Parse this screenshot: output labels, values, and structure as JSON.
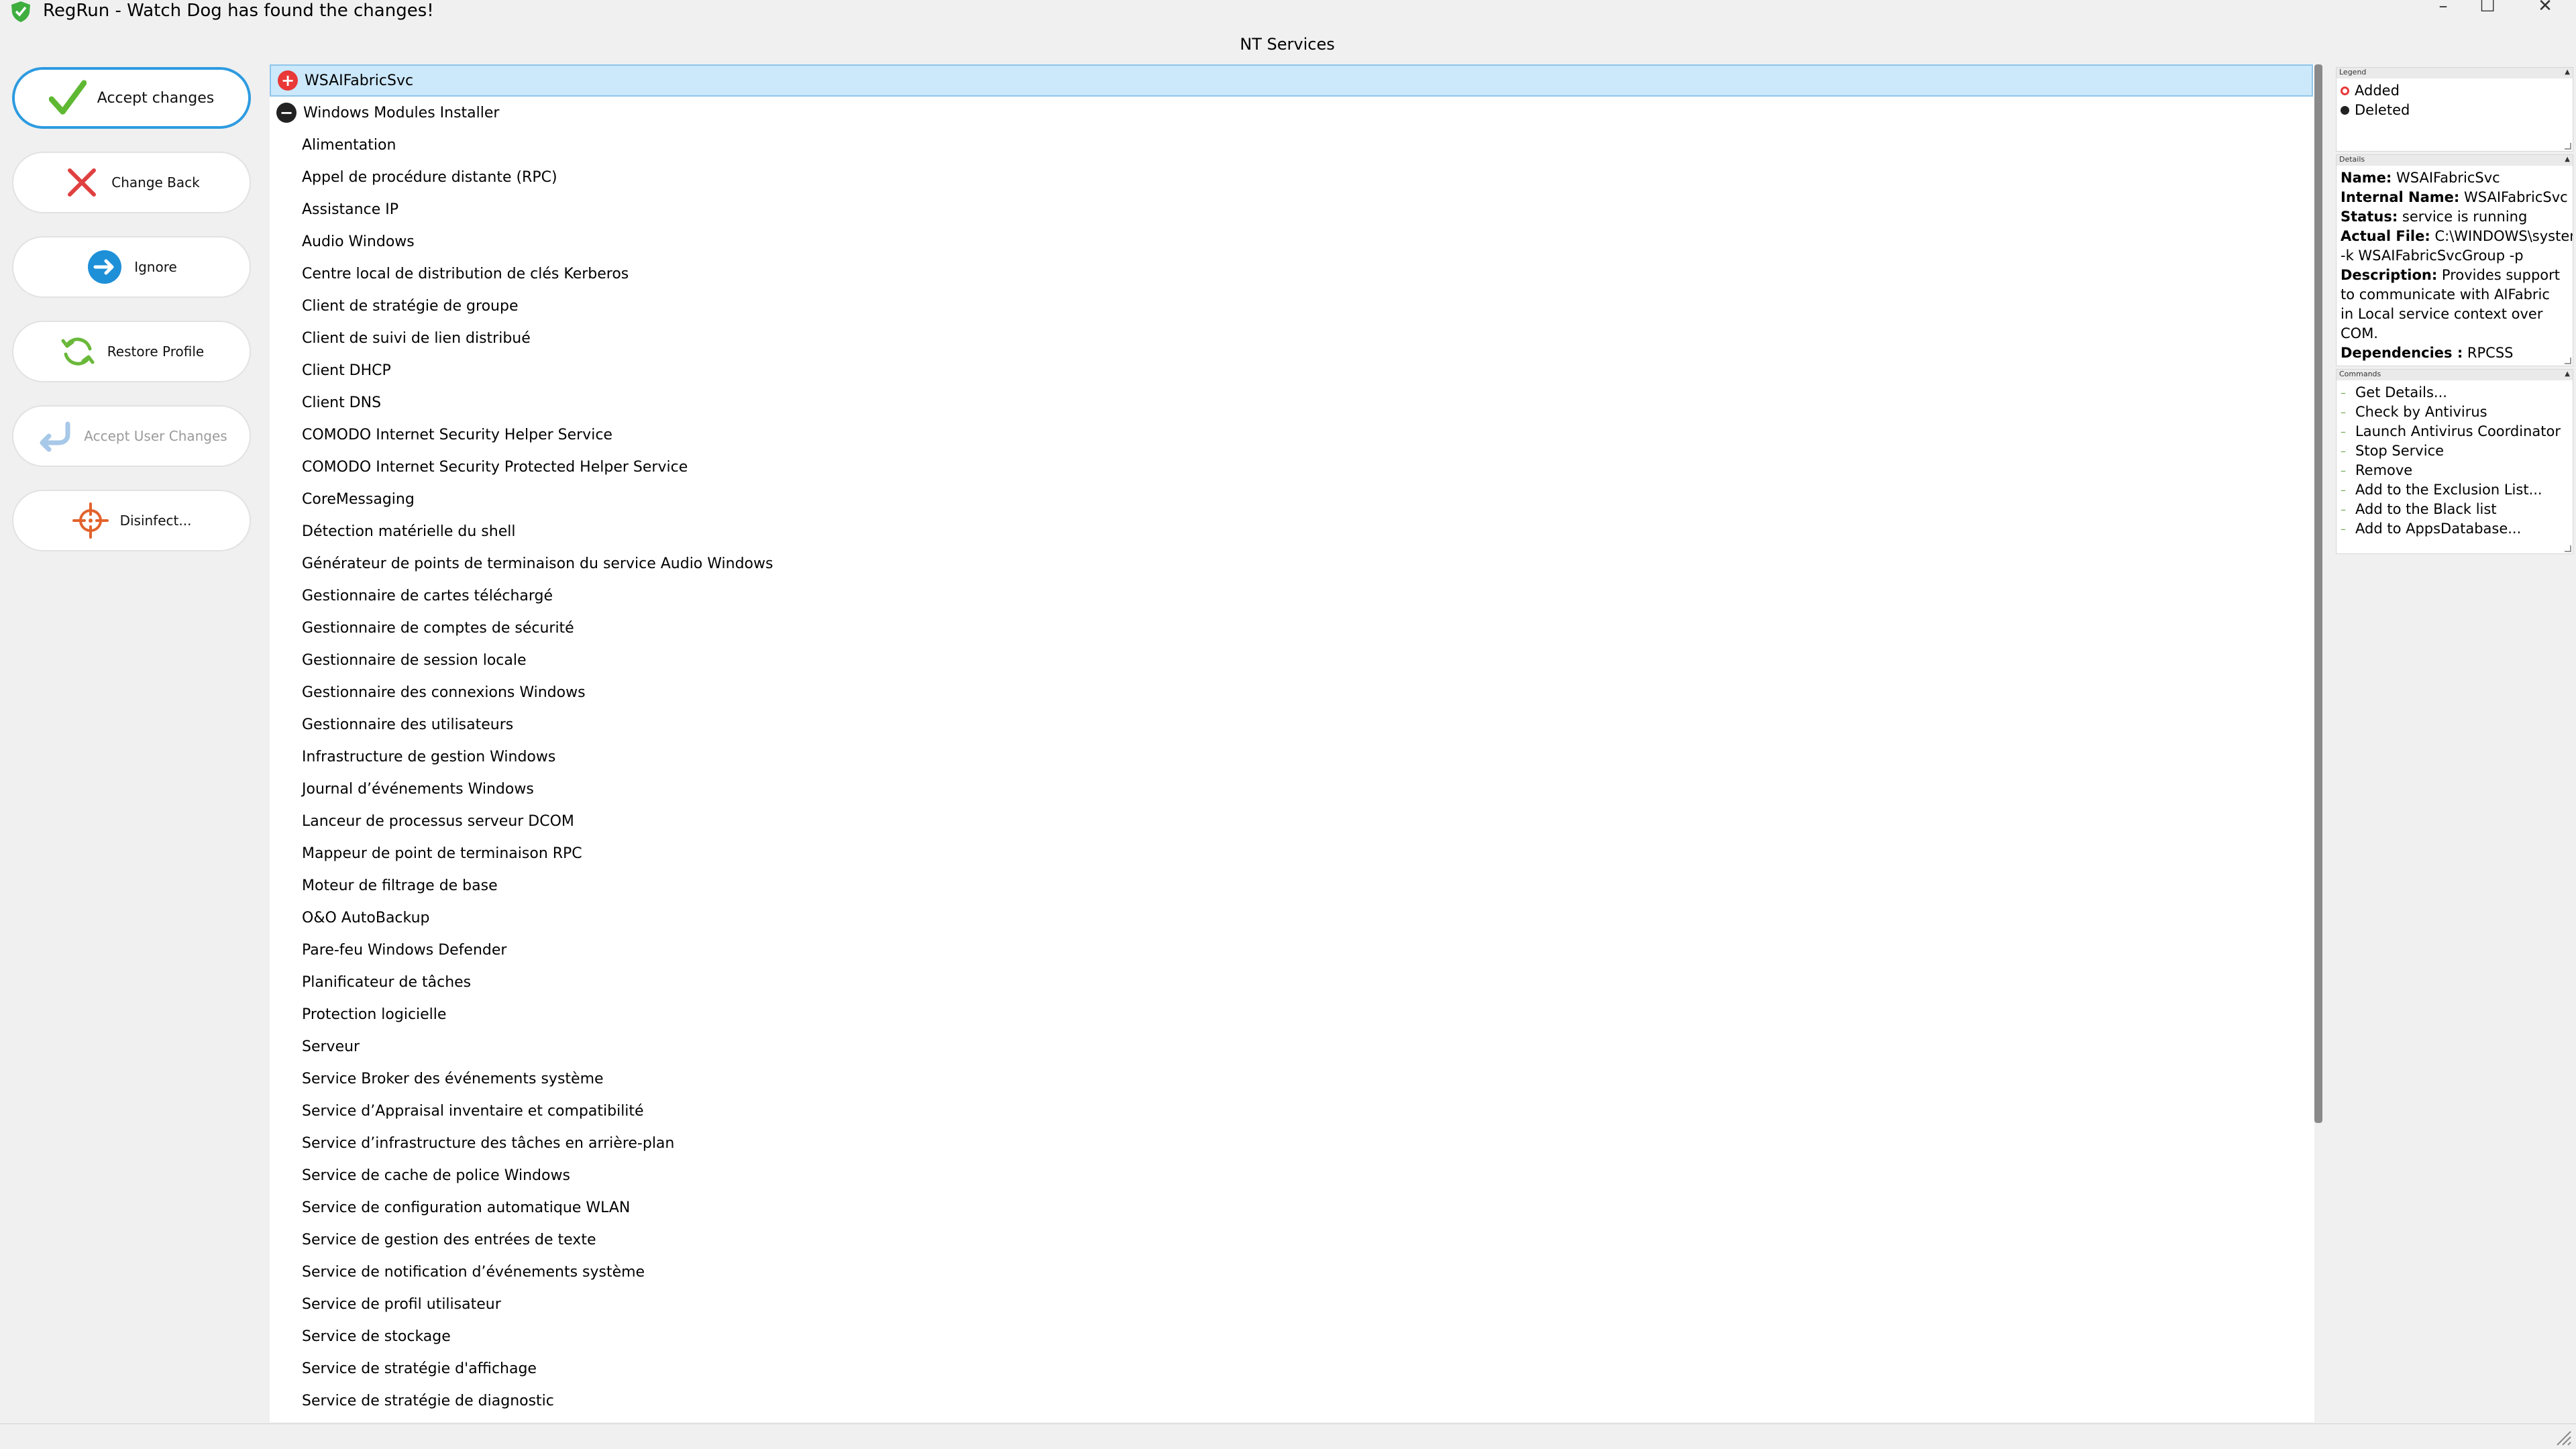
{
  "window": {
    "title": "RegRun - Watch Dog has found the changes!",
    "minimize": "–",
    "maximize": "☐",
    "close": "✕"
  },
  "section_title": "NT Services",
  "sidebar": [
    {
      "label": "Accept changes",
      "icon": "checkmark-icon"
    },
    {
      "label": "Change Back",
      "icon": "red-x-icon"
    },
    {
      "label": "Ignore",
      "icon": "arrow-right-circle-icon"
    },
    {
      "label": "Restore Profile",
      "icon": "refresh-icon"
    },
    {
      "label": "Accept User Changes",
      "icon": "return-arrow-icon"
    },
    {
      "label": "Disinfect...",
      "icon": "crosshair-icon"
    }
  ],
  "services": [
    {
      "name": "WSAIFabricSvc",
      "status": "added",
      "selected": true
    },
    {
      "name": "Windows Modules Installer",
      "status": "deleted"
    },
    {
      "name": "Alimentation"
    },
    {
      "name": "Appel de procédure distante (RPC)"
    },
    {
      "name": "Assistance IP"
    },
    {
      "name": "Audio Windows"
    },
    {
      "name": "Centre local de distribution de clés Kerberos"
    },
    {
      "name": "Client de stratégie de groupe"
    },
    {
      "name": "Client de suivi de lien distribué"
    },
    {
      "name": "Client DHCP"
    },
    {
      "name": "Client DNS"
    },
    {
      "name": "COMODO Internet Security Helper Service"
    },
    {
      "name": "COMODO Internet Security Protected Helper Service"
    },
    {
      "name": "CoreMessaging"
    },
    {
      "name": "Détection matérielle du shell"
    },
    {
      "name": "Générateur de points de terminaison du service Audio Windows"
    },
    {
      "name": "Gestionnaire de cartes téléchargé"
    },
    {
      "name": "Gestionnaire de comptes de sécurité"
    },
    {
      "name": "Gestionnaire de session locale"
    },
    {
      "name": "Gestionnaire des connexions Windows"
    },
    {
      "name": "Gestionnaire des utilisateurs"
    },
    {
      "name": "Infrastructure de gestion Windows"
    },
    {
      "name": "Journal d’événements Windows"
    },
    {
      "name": "Lanceur de processus serveur DCOM"
    },
    {
      "name": "Mappeur de point de terminaison RPC"
    },
    {
      "name": "Moteur de filtrage de base"
    },
    {
      "name": "O&O AutoBackup"
    },
    {
      "name": "Pare-feu Windows Defender"
    },
    {
      "name": "Planificateur de tâches"
    },
    {
      "name": "Protection logicielle"
    },
    {
      "name": "Serveur"
    },
    {
      "name": "Service Broker des événements système"
    },
    {
      "name": "Service d’Appraisal inventaire et compatibilité"
    },
    {
      "name": "Service d’infrastructure des tâches en arrière-plan"
    },
    {
      "name": "Service de cache de police Windows"
    },
    {
      "name": "Service de configuration automatique WLAN"
    },
    {
      "name": "Service de gestion des entrées de texte"
    },
    {
      "name": "Service de notification d’événements système"
    },
    {
      "name": "Service de profil utilisateur"
    },
    {
      "name": "Service de stockage"
    },
    {
      "name": "Service de stratégie d'affichage"
    },
    {
      "name": "Service de stratégie de diagnostic"
    }
  ],
  "legend": {
    "header": "Legend",
    "added": "Added",
    "deleted": "Deleted"
  },
  "details": {
    "header": "Details",
    "name_label": "Name:",
    "name_value": "WSAIFabricSvc",
    "internal_label": "Internal Name:",
    "internal_value": "WSAIFabricSvc",
    "status_label": "Status:",
    "status_value": "service is running",
    "file_label": "Actual File:",
    "file_value": "C:\\WINDOWS\\systen",
    "file_value_2": "-k WSAIFabricSvcGroup -p",
    "desc_label": "Description:",
    "desc_value": "Provides support",
    "desc_value_2": "to communicate with AIFabric",
    "desc_value_3": "in Local service context over",
    "desc_value_4": "COM.",
    "deps_label": "Dependencies :",
    "deps_value": "RPCSS"
  },
  "commands": {
    "header": "Commands",
    "items": [
      "Get Details...",
      "Check by Antivirus",
      "Launch Antivirus Coordinator",
      "Stop Service",
      "Remove",
      "Add to the Exclusion List...",
      "Add to the Black list",
      "Add to AppsDatabase..."
    ]
  },
  "colors": {
    "accent": "#2d9be0",
    "selected_row": "#cce8fb",
    "added": "#e83838",
    "deleted": "#222222"
  }
}
